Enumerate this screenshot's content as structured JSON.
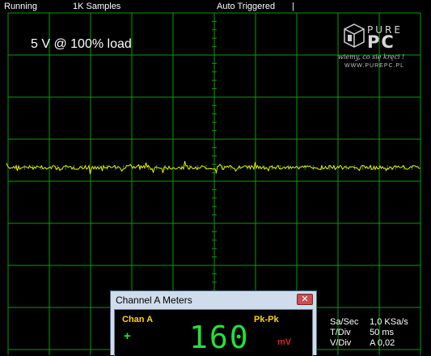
{
  "status": {
    "running": "Running",
    "samples": "1K Samples",
    "trigger": "Auto Triggered",
    "cursor": "|"
  },
  "caption": "5 V @ 100% load",
  "logo": {
    "pure": "PURE",
    "pc": "PC",
    "tagline": "wiemy, co się kręci !",
    "url": "WWW.PUREPC.PL"
  },
  "info": {
    "rate_label": "Sa/Sec",
    "rate_value": "1,0 KSa/s",
    "tdiv_label": "T/Div",
    "tdiv_value": "50 ms",
    "vdiv_label": "V/Div",
    "vdiv_value": "A 0,02"
  },
  "meters": {
    "title": "Channel A Meters",
    "close": "✕",
    "channel": "Chan A",
    "mode": "Pk-Pk",
    "sign": "+",
    "value": "160",
    "unit": "mV"
  },
  "colors": {
    "grid": "#00a000",
    "trace": "#f0f000",
    "meter_digits": "#22e03a",
    "labels": "#ffd400",
    "unit": "#e02020"
  }
}
